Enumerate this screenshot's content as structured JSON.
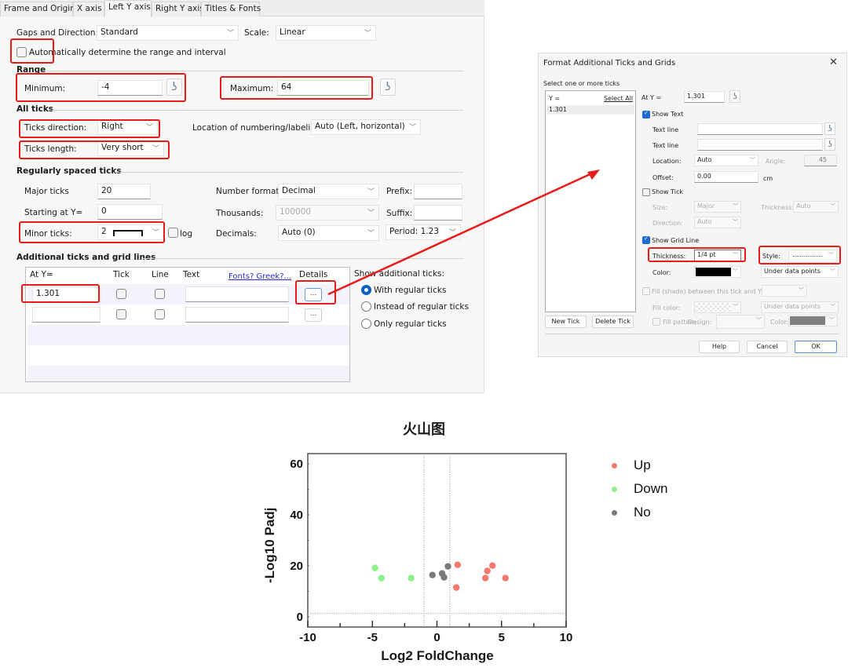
{
  "left_dialog": {
    "tabs": [
      "Frame and Origin",
      "X axis",
      "Left Y axis",
      "Right Y axis",
      "Titles & Fonts"
    ],
    "active_tab": "Left Y axis",
    "gaps_label": "Gaps and Direction:",
    "gaps_value": "Standard",
    "scale_label": "Scale:",
    "scale_value": "Linear",
    "auto_range_label": "Automatically determine the range and interval",
    "auto_range_checked": false,
    "range_heading": "Range",
    "minimum_label": "Minimum:",
    "minimum_value": "-4",
    "maximum_label": "Maximum:",
    "maximum_value": "64",
    "all_ticks_heading": "All ticks",
    "ticks_direction_label": "Ticks direction:",
    "ticks_direction_value": "Right",
    "location_label": "Location of numbering/labeling:",
    "location_value": "Auto (Left, horizontal)",
    "ticks_length_label": "Ticks length:",
    "ticks_length_value": "Very short",
    "regular_heading": "Regularly spaced ticks",
    "major_ticks_label": "Major ticks",
    "major_ticks_value": "20",
    "starting_label": "Starting at Y=",
    "starting_value": "0",
    "minor_ticks_label": "Minor ticks:",
    "minor_ticks_value": "2",
    "log_label": "log",
    "number_format_label": "Number format:",
    "number_format_value": "Decimal",
    "thousands_label": "Thousands:",
    "thousands_value": "100000",
    "decimals_label": "Decimals:",
    "decimals_value": "Auto (0)",
    "prefix_label": "Prefix:",
    "suffix_label": "Suffix:",
    "period_value": "Period: 1.23",
    "additional_heading": "Additional ticks and grid lines",
    "grid_headers": [
      "At Y=",
      "Tick",
      "Line",
      "Text",
      "Details"
    ],
    "fonts_link": "Fonts? Greek?...",
    "grid_rows": [
      {
        "at_y": "1.301",
        "tick": false,
        "line": false,
        "text": "",
        "details": "..."
      },
      {
        "at_y": "",
        "tick": false,
        "line": false,
        "text": "",
        "details": "..."
      }
    ],
    "show_additional_label": "Show additional ticks:",
    "show_options": [
      "With regular ticks",
      "Instead of regular ticks",
      "Only regular ticks"
    ],
    "show_selected": "With regular ticks"
  },
  "right_dialog": {
    "title": "Format Additional Ticks and Grids",
    "select_label": "Select one or more ticks",
    "list_header": "Y =",
    "select_all": "Select All",
    "list_items": [
      "1.301"
    ],
    "at_y_label": "At Y =",
    "at_y_value": "1.301",
    "show_text_label": "Show Text",
    "show_text_checked": true,
    "text_line_label": "Text line",
    "location_label": "Location:",
    "location_value": "Auto",
    "angle_label": "Angle:",
    "angle_value": "45",
    "offset_label": "Offset:",
    "offset_value": "0.00",
    "offset_unit": "cm",
    "show_tick_label": "Show Tick",
    "show_tick_checked": false,
    "size_label": "Size:",
    "size_value": "Major",
    "thickness_tick_label": "Thickness:",
    "thickness_tick_value": "Auto",
    "direction_label": "Direction:",
    "direction_value": "Auto",
    "show_grid_label": "Show Grid Line",
    "show_grid_checked": true,
    "thickness_label": "Thickness:",
    "thickness_value": "1/4 pt",
    "style_label": "Style:",
    "color_label": "Color:",
    "grid_color": "#000000",
    "layer_value": "Under data points",
    "fill_label": "Fill (shade) between this tick and Y =",
    "fill_color_label": "Fill color:",
    "fill_layer_value": "Under data points",
    "fill_pattern_label": "Fill pattern",
    "design_label": "Design:",
    "pattern_color_label": "Color:",
    "pattern_color": "#808080",
    "new_tick": "New Tick",
    "delete_tick": "Delete Tick",
    "help": "Help",
    "cancel": "Cancel",
    "ok": "OK"
  },
  "chart_data": {
    "type": "scatter",
    "title": "火山图",
    "xlabel": "Log2 FoldChange",
    "ylabel": "-Log10 Padj",
    "xlim": [
      -10,
      10
    ],
    "ylim": [
      -4,
      64
    ],
    "xticks": [
      -10,
      -5,
      0,
      5,
      10
    ],
    "yticks": [
      0,
      20,
      40,
      60
    ],
    "x_minor_ticks": [
      -7.5,
      -2.5,
      2.5,
      7.5
    ],
    "y_minor_ticks": [
      10,
      30,
      50
    ],
    "reference_lines": {
      "vertical": [
        -1,
        1
      ],
      "horizontal": [
        1.301
      ],
      "style": "dotted"
    },
    "grid": false,
    "legend_position": "right",
    "series": [
      {
        "name": "Up",
        "color": "#f4786e",
        "points": [
          [
            1.6,
            20.4
          ],
          [
            1.5,
            11.5
          ],
          [
            4.3,
            20.1
          ],
          [
            3.9,
            18.0
          ],
          [
            3.75,
            15.2
          ],
          [
            5.3,
            15.2
          ]
        ]
      },
      {
        "name": "Down",
        "color": "#8ef08a",
        "points": [
          [
            -4.8,
            19.2
          ],
          [
            -4.3,
            15.2
          ],
          [
            -2.0,
            15.2
          ]
        ]
      },
      {
        "name": "No",
        "color": "#7a7a7a",
        "points": [
          [
            -0.35,
            16.4
          ],
          [
            0.4,
            17.0
          ],
          [
            0.55,
            15.5
          ],
          [
            0.85,
            19.8
          ]
        ]
      }
    ]
  }
}
